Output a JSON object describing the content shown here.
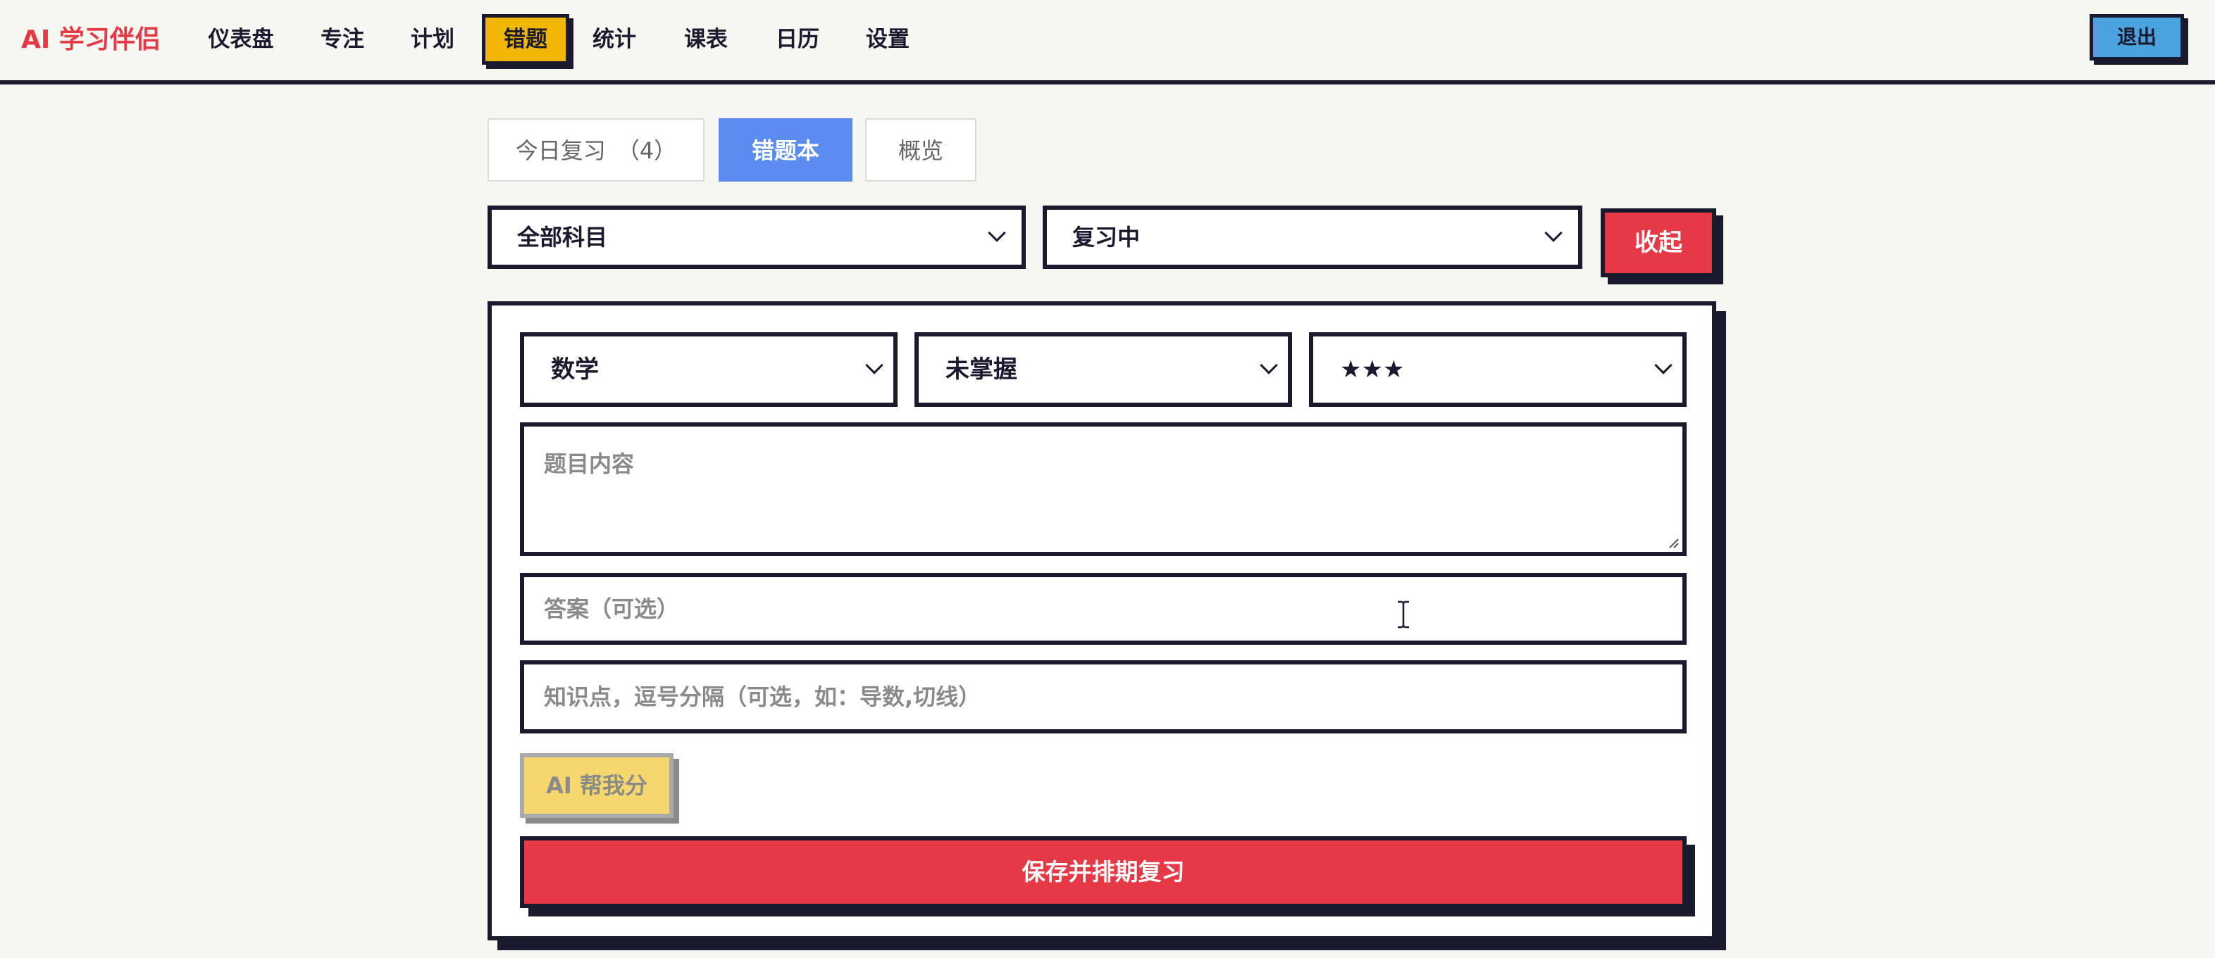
{
  "nav": {
    "brand": "AI 学习伴侣",
    "items": [
      {
        "label": "仪表盘"
      },
      {
        "label": "专注"
      },
      {
        "label": "计划"
      },
      {
        "label": "错题"
      },
      {
        "label": "统计"
      },
      {
        "label": "课表"
      },
      {
        "label": "日历"
      },
      {
        "label": "设置"
      }
    ],
    "active_index": 3,
    "logout_label": "退出"
  },
  "tabs": {
    "review_today_label": "今日复习",
    "review_today_count": "（4）",
    "mistakes_label": "错题本",
    "overview_label": "概览",
    "active": "错题本"
  },
  "filters": {
    "subject_selected": "全部科目",
    "status_selected": "复习中",
    "collapse_label": "收起"
  },
  "form": {
    "subject_selected": "数学",
    "mastery_selected": "未掌握",
    "difficulty_selected": "★★★",
    "question_placeholder": "题目内容",
    "answer_placeholder": "答案（可选）",
    "knowledge_placeholder": "知识点，逗号分隔（可选，如：导数,切线）",
    "ai_button_label": "AI 帮我分",
    "save_button_label": "保存并排期复习"
  },
  "colors": {
    "accent_red": "#e63946",
    "accent_blue": "#5b8def",
    "accent_yellow": "#f2b705",
    "ink": "#1a1a2e",
    "background": "#f7f7f2"
  }
}
